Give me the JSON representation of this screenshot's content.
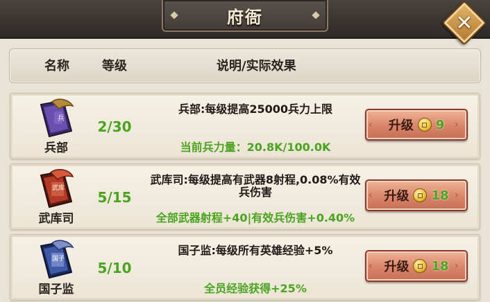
{
  "window": {
    "title": "府衙"
  },
  "colors": {
    "accent_green": "#4aa321",
    "button_red": "#d9856a",
    "coin_gold": "#e8bd3a"
  },
  "header": {
    "col_name": "名称",
    "col_level": "等级",
    "col_desc": "说明/实际效果"
  },
  "rows": [
    {
      "name": "兵部",
      "icon": "scroll-flag-icon-purple",
      "level": "2/30",
      "description": "兵部:每级提高25000兵力上限",
      "effect": "当前兵力量：20.8K/100.0K",
      "button_label": "升级",
      "cost": "9"
    },
    {
      "name": "武库司",
      "icon": "scroll-flag-icon-red",
      "icon_text": "武库",
      "level": "5/15",
      "description": "武库司:每级提高有武器8射程,0.08%有效兵伤害",
      "effect": "全部武器射程+40|有效兵伤害+0.40%",
      "button_label": "升级",
      "cost": "18"
    },
    {
      "name": "国子监",
      "icon": "scroll-flag-icon-blue",
      "icon_text": "国子",
      "level": "5/10",
      "description": "国子监:每级所有英雄经验+5%",
      "effect": "全员经验获得+25%",
      "button_label": "升级",
      "cost": "18"
    }
  ]
}
